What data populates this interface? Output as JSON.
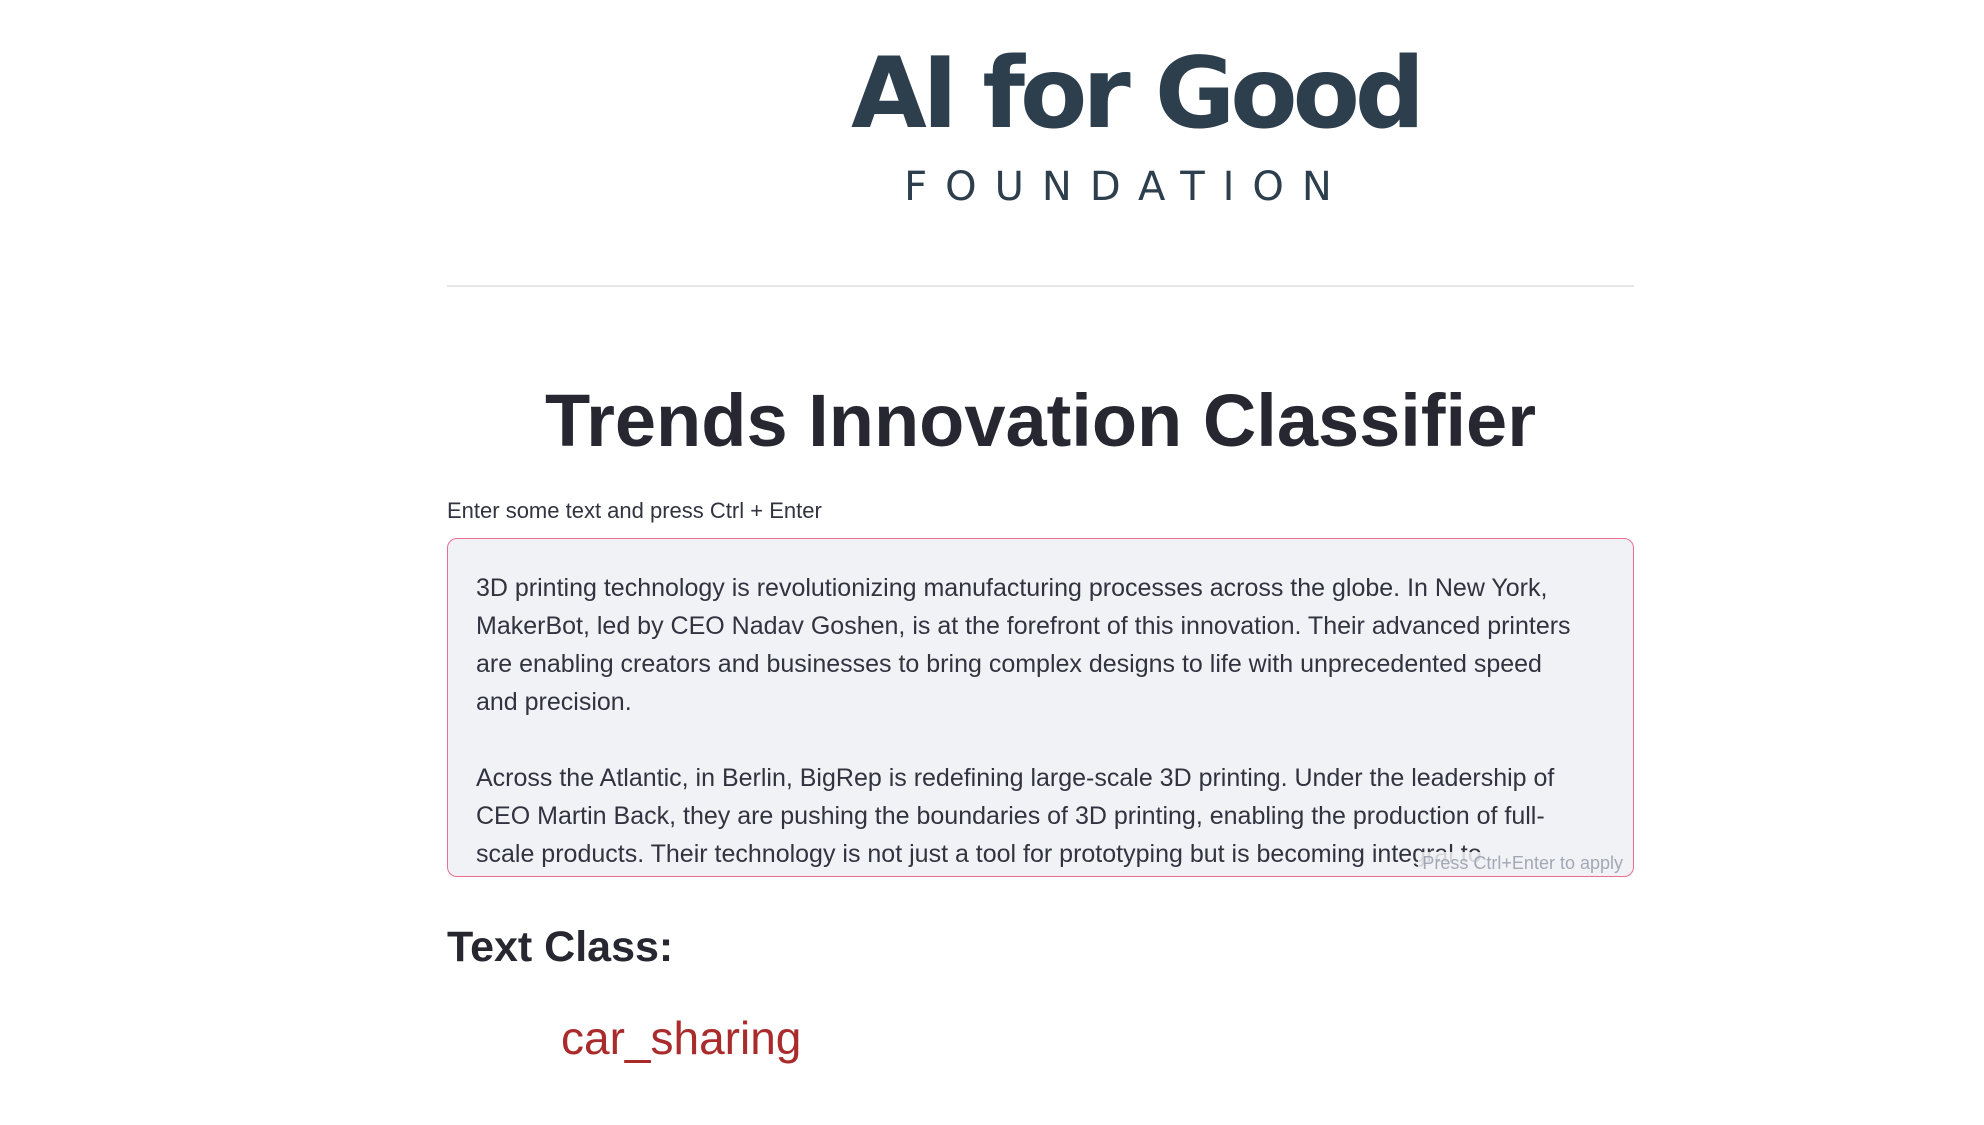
{
  "logo": {
    "main": "AI for Good",
    "sub": "FOUNDATION"
  },
  "page": {
    "title": "Trends Innovation Classifier"
  },
  "input": {
    "label": "Enter some text and press Ctrl + Enter",
    "value": "3D printing technology is revolutionizing manufacturing processes across the globe. In New York, MakerBot, led by CEO Nadav Goshen, is at the forefront of this innovation. Their advanced printers are enabling creators and businesses to bring complex designs to life with unprecedented speed and precision.\n\nAcross the Atlantic, in Berlin, BigRep is redefining large-scale 3D printing. Under the leadership of CEO Martin Back, they are pushing the boundaries of 3D printing, enabling the production of full-scale products. Their technology is not just a tool for prototyping but is becoming integral to",
    "hint": "Press Ctrl+Enter to apply"
  },
  "result": {
    "heading": "Text Class:",
    "value": "car_sharing"
  },
  "colors": {
    "logo": "#2d3e4d",
    "input_border": "#e8708e",
    "input_background": "#f0f2f6",
    "result_text": "#a92b2b"
  }
}
